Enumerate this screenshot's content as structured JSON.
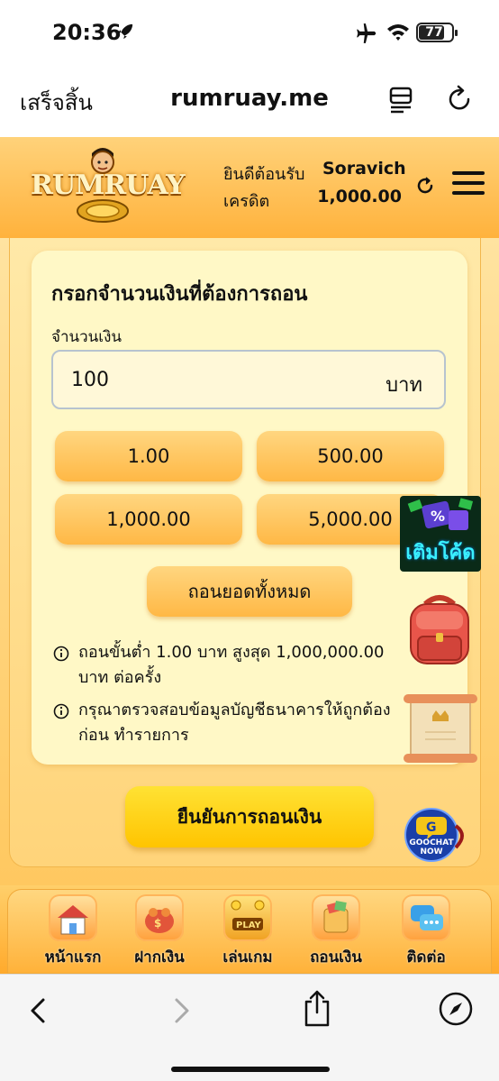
{
  "status_bar": {
    "time": "20:36",
    "battery": "77"
  },
  "safari": {
    "done_label": "เสร็จสิ้น",
    "url": "rumruay.me"
  },
  "header": {
    "logo_text": "RUMRUAY",
    "welcome_label": "ยินดีต้อนรับ",
    "username": "Soravich",
    "credit_label": "เครดิต",
    "credit_value": "1,000.00"
  },
  "withdraw_form": {
    "title": "กรอกจำนวนเงินที่ต้องการถอน",
    "amount_label": "จำนวนเงิน",
    "amount_value": "100",
    "currency_unit": "บาท",
    "quick_amounts": [
      "1.00",
      "500.00",
      "1,000.00",
      "5,000.00"
    ],
    "withdraw_all_label": "ถอนยอดทั้งหมด",
    "notes": [
      "ถอนขั้นต่ำ 1.00 บาท สูงสุด 1,000,000.00 บาท ต่อครั้ง",
      "กรุณาตรวจสอบข้อมูลบัญชีธนาคารให้ถูกต้องก่อน ทำรายการ"
    ],
    "confirm_label": "ยืนยันการถอนเงิน"
  },
  "floating": {
    "promo_text": "เติมโค้ด",
    "chat_label": "GOOCHAT NOW"
  },
  "bottom_nav": [
    {
      "label": "หน้าแรก",
      "icon": "home-icon"
    },
    {
      "label": "ฝากเงิน",
      "icon": "deposit-icon"
    },
    {
      "label": "เล่นเกม",
      "icon": "play-icon"
    },
    {
      "label": "ถอนเงิน",
      "icon": "withdraw-icon"
    },
    {
      "label": "ติดต่อ",
      "icon": "chat-icon"
    }
  ],
  "colors": {
    "accent": "#ffb845",
    "confirm": "#ffd000"
  }
}
